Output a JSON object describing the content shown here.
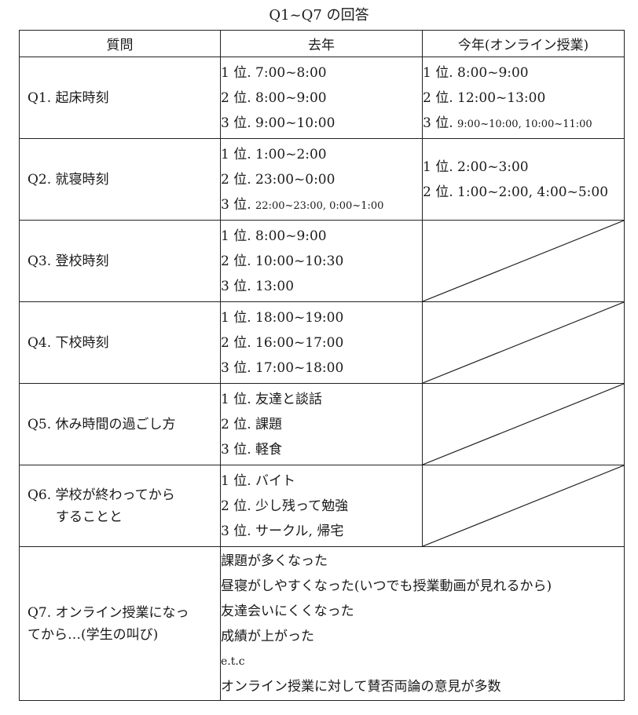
{
  "caption": "Q1~Q7 の回答",
  "headers": {
    "question": "質問",
    "last_year": "去年",
    "this_year": "今年(オンライン授業)"
  },
  "rows": [
    {
      "question": "Q1.  起床時刻",
      "last_year": [
        "1 位. 7:00~8:00",
        "2 位. 8:00~9:00",
        "3 位. 9:00~10:00"
      ],
      "this_year": [
        "1 位. 8:00~9:00",
        "2 位. 12:00~13:00"
      ],
      "this_year_rank3_prefix": "3 位.",
      "this_year_rank3_small": "9:00~10:00, 10:00~11:00"
    },
    {
      "question": "Q2.  就寝時刻",
      "last_year": [
        "1 位. 1:00~2:00",
        "2 位. 23:00~0:00"
      ],
      "last_year_rank3_prefix": "3 位.",
      "last_year_rank3_small": "22:00~23:00, 0:00~1:00",
      "this_year": [
        "1 位. 2:00~3:00",
        "2 位. 1:00~2:00, 4:00~5:00"
      ]
    },
    {
      "question": "Q3.  登校時刻",
      "last_year": [
        "1 位. 8:00~9:00",
        "2 位. 10:00~10:30",
        "3 位. 13:00"
      ]
    },
    {
      "question": "Q4.  下校時刻",
      "last_year": [
        "1 位. 18:00~19:00",
        "2 位. 16:00~17:00",
        "3 位. 17:00~18:00"
      ]
    },
    {
      "question": "Q5.  休み時間の過ごし方",
      "last_year": [
        "1 位.  友達と談話",
        "2 位.  課題",
        "3 位.  軽食"
      ]
    },
    {
      "question_line1": "Q6.  学校が終わってから",
      "question_line2": "することと",
      "last_year": [
        "1 位.  バイト",
        "2 位.  少し残って勉強",
        "3 位.  サークル, 帰宅"
      ]
    },
    {
      "question_line1": "Q7.  オンライン授業になっ",
      "question_line2": "てから…(学生の叫び)",
      "answers": [
        "課題が多くなった",
        "昼寝がしやすくなった(いつでも授業動画が見れるから)",
        "友達会いにくくなった",
        "成績が上がった",
        "e.t.c",
        "オンライン授業に対して賛否両論の意見が多数"
      ]
    }
  ]
}
